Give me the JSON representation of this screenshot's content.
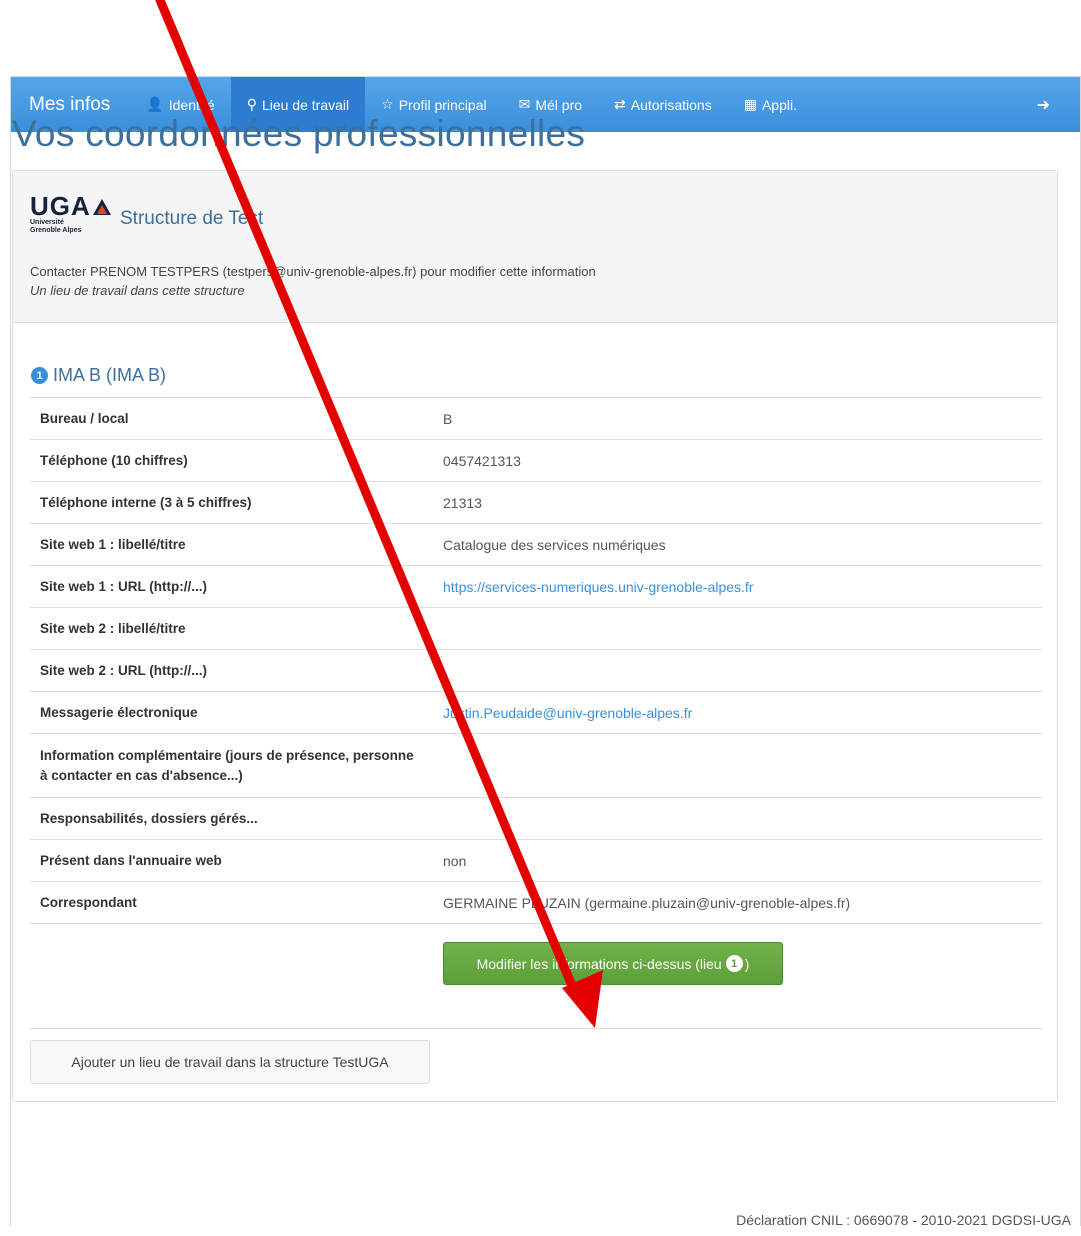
{
  "navbar": {
    "brand": "Mes infos",
    "items": [
      {
        "icon": "user-icon",
        "label": "Identité"
      },
      {
        "icon": "map-marker-icon",
        "label": "Lieu de travail",
        "active": true
      },
      {
        "icon": "star-icon",
        "label": "Profil principal"
      },
      {
        "icon": "envelope-icon",
        "label": "Mél pro"
      },
      {
        "icon": "transfer-icon",
        "label": "Autorisations"
      },
      {
        "icon": "grid-icon",
        "label": "Appli."
      }
    ],
    "logout_icon": "logout-icon",
    "color": "#3a8fdc"
  },
  "page": {
    "title": "Vos coordonnées professionnelles"
  },
  "structure": {
    "logo": {
      "text": "UGA",
      "subtext_line1": "Université",
      "subtext_line2": "Grenoble Alpes"
    },
    "name": "Structure de Test",
    "contact": "Contacter PRENOM TESTPERS (testpers@univ-grenoble-alpes.fr) pour modifier cette information",
    "note": "Un lieu de travail dans cette structure"
  },
  "location": {
    "number": "1",
    "title": "IMA B (IMA B)",
    "rows": [
      {
        "label": "Bureau / local",
        "value": "B"
      },
      {
        "label": "Téléphone (10 chiffres)",
        "value": "0457421313"
      },
      {
        "label": "Téléphone interne (3 à 5 chiffres)",
        "value": "21313"
      },
      {
        "label": "Site web 1 : libellé/titre",
        "value": "Catalogue des services numériques"
      },
      {
        "label": "Site web 1 : URL (http://...)",
        "value": "https://services-numeriques.univ-grenoble-alpes.fr",
        "link": true
      },
      {
        "label": "Site web 2 : libellé/titre",
        "value": ""
      },
      {
        "label": "Site web 2 : URL (http://...)",
        "value": ""
      },
      {
        "label": "Messagerie électronique",
        "value": "Justin.Peudaide@univ-grenoble-alpes.fr",
        "link": true
      },
      {
        "label": "Information complémentaire (jours de présence, personne à contacter en cas d'absence...)",
        "value": "",
        "tall": true
      },
      {
        "label": "Responsabilités, dossiers gérés...",
        "value": ""
      },
      {
        "label": "Présent dans l'annuaire web",
        "value": "non"
      },
      {
        "label": "Correspondant",
        "value": "GERMAINE PLUZAIN (germaine.pluzain@univ-grenoble-alpes.fr)"
      }
    ],
    "modify_button": {
      "label": "Modifier les informations ci-dessus (lieu ",
      "badge": "1",
      "suffix": ")"
    }
  },
  "add_button": "Ajouter un lieu de travail dans la structure  TestUGA",
  "footer": "Déclaration CNIL : 0669078 - 2010-2021 DGDSI-UGA",
  "annotation": {
    "type": "red-arrow",
    "color": "#e50000"
  }
}
